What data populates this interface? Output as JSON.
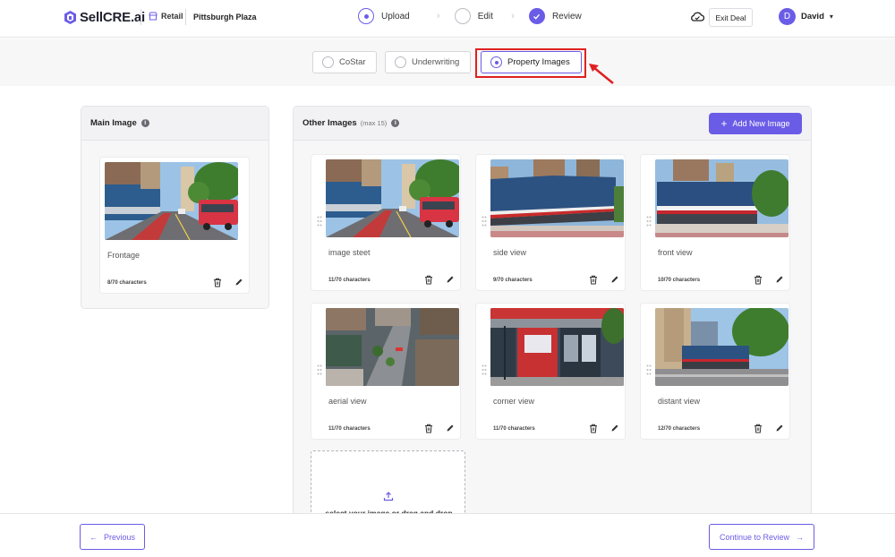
{
  "header": {
    "brand": "SellCRE.ai",
    "property_type": "Retail",
    "property_name": "Pittsburgh Plaza",
    "steps": [
      {
        "label": "Upload",
        "state": "active"
      },
      {
        "label": "Edit",
        "state": "pending"
      },
      {
        "label": "Review",
        "state": "done"
      }
    ],
    "exit_label": "Exit Deal",
    "user_initial": "D",
    "user_name": "David",
    "accent_color": "#6b5ce7"
  },
  "tabs": [
    {
      "label": "CoStar",
      "selected": false
    },
    {
      "label": "Underwriting",
      "selected": false
    },
    {
      "label": "Property Images",
      "selected": true
    }
  ],
  "main_image": {
    "title": "Main Image",
    "card": {
      "caption": "Frontage",
      "chars": "8/70 characters",
      "scene": "street"
    }
  },
  "other_images": {
    "title": "Other Images",
    "max_note": "(max 15)",
    "add_label": "Add New Image",
    "cards": [
      {
        "caption": "image steet",
        "chars": "11/70 characters",
        "scene": "street"
      },
      {
        "caption": "side view",
        "chars": "9/70 characters",
        "scene": "building-side"
      },
      {
        "caption": "front view",
        "chars": "10/70 characters",
        "scene": "building-front"
      },
      {
        "caption": "aerial view",
        "chars": "11/70 characters",
        "scene": "aerial"
      },
      {
        "caption": "corner view",
        "chars": "11/70 characters",
        "scene": "corner"
      },
      {
        "caption": "distant view",
        "chars": "12/70 characters",
        "scene": "distant"
      }
    ],
    "upload_text": "select your image or drag and drop"
  },
  "footer": {
    "previous_label": "Previous",
    "continue_label": "Continue to Review"
  }
}
